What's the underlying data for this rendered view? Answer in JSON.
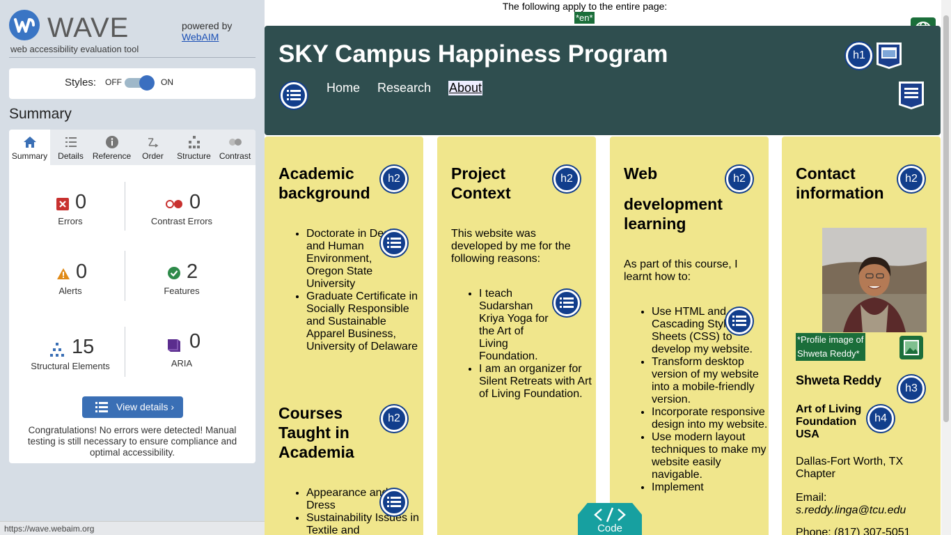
{
  "wave": {
    "title": "WAVE",
    "subtitle": "web accessibility evaluation tool",
    "powered_by": "powered by",
    "webaim": "WebAIM",
    "styles_label": "Styles:",
    "styles_off": "OFF",
    "styles_on": "ON",
    "summary_heading": "Summary",
    "tabs": [
      {
        "label": "Summary",
        "icon": "home-icon"
      },
      {
        "label": "Details",
        "icon": "details-list-icon"
      },
      {
        "label": "Reference",
        "icon": "info-icon"
      },
      {
        "label": "Order",
        "icon": "order-icon"
      },
      {
        "label": "Structure",
        "icon": "structure-icon"
      },
      {
        "label": "Contrast",
        "icon": "contrast-icon"
      }
    ],
    "stats": {
      "errors": {
        "value": "0",
        "label": "Errors"
      },
      "contrast_errors": {
        "value": "0",
        "label": "Contrast Errors"
      },
      "alerts": {
        "value": "0",
        "label": "Alerts"
      },
      "features": {
        "value": "2",
        "label": "Features"
      },
      "structural": {
        "value": "15",
        "label": "Structural Elements"
      },
      "aria": {
        "value": "0",
        "label": "ARIA"
      }
    },
    "view_details": "View details ›",
    "congrats": "Congratulations! No errors were detected! Manual testing is still necessary to ensure compliance and optimal accessibility.",
    "status_url": "https://wave.webaim.org",
    "colors": {
      "accent": "#3a6fb5",
      "sidebar_bg": "#d6dde5"
    }
  },
  "page": {
    "notice": "The following apply to the entire page:",
    "lang": "*en*",
    "site_title": "SKY Campus Happiness Program",
    "nav": {
      "home": "Home",
      "research": "Research",
      "about": "About"
    },
    "h1_badge": "h1",
    "h2_badge": "h2",
    "h3_badge": "h3",
    "h4_badge": "h4",
    "code_label": "Code",
    "col1": {
      "heading": "Academic background",
      "items": [
        "Doctorate in Design and Human Environment, Oregon State University",
        "Graduate Certificate in Socially Responsible and Sustainable Apparel Business, University of Delaware"
      ],
      "heading2": "Courses Taught in Academia",
      "items2": [
        "Appearance and Dress",
        "Sustainability Issues in Textile and"
      ]
    },
    "col2": {
      "heading": "Project Context",
      "para": "This website was developed by me for the following reasons:",
      "items": [
        "I teach Sudarshan Kriya Yoga for the Art of Living Foundation.",
        "I am an organizer for Silent Retreats with Art of Living Foundation."
      ]
    },
    "col3": {
      "heading_a": "Web",
      "heading_b": "development learning",
      "para": "As part of this course, I learnt how to:",
      "items": [
        "Use HTML and Cascading Style Sheets (CSS) to develop my website.",
        "Transform desktop version of my website into a mobile-friendly version.",
        "Incorporate responsive design into my website.",
        "Use modern layout techniques to make my website easily navigable.",
        "Implement"
      ]
    },
    "col4": {
      "heading": "Contact information",
      "alt_text": "*Profile image of Shweta Reddy*",
      "name": "Shweta Reddy",
      "org": "Art of Living Foundation USA",
      "chapter": "Dallas-Fort Worth, TX Chapter",
      "email_label": "Email:",
      "email": "s.reddy.linga@tcu.edu",
      "phone": "Phone: (817) 307-5051"
    }
  }
}
